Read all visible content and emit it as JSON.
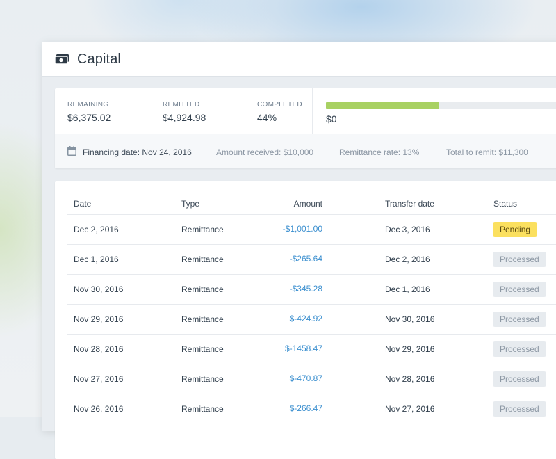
{
  "header": {
    "title": "Capital",
    "icon": "cash-icon"
  },
  "summary": {
    "remaining": {
      "label": "REMAINING",
      "value": "$6,375.02"
    },
    "remitted": {
      "label": "REMITTED",
      "value": "$4,924.98"
    },
    "completed": {
      "label": "COMPLETED",
      "value": "44%"
    },
    "progress": {
      "fraction": 0.44,
      "value_label": "$0",
      "fill_color": "#a8d162"
    },
    "financing_date": "Financing date: Nov 24, 2016",
    "amount_received": "Amount received: $10,000",
    "remittance_rate": "Remittance rate: 13%",
    "total_to_remit": "Total to remit: $11,300"
  },
  "table": {
    "headers": {
      "date": "Date",
      "type": "Type",
      "amount": "Amount",
      "transfer_date": "Transfer date",
      "status": "Status"
    },
    "rows": [
      {
        "date": "Dec 2, 2016",
        "type": "Remittance",
        "amount": "-$1,001.00",
        "transfer_date": "Dec 3, 2016",
        "status": "Pending",
        "status_kind": "pending"
      },
      {
        "date": "Dec 1, 2016",
        "type": "Remittance",
        "amount": "-$265.64",
        "transfer_date": "Dec 2, 2016",
        "status": "Processed",
        "status_kind": "processed"
      },
      {
        "date": "Nov 30, 2016",
        "type": "Remittance",
        "amount": "-$345.28",
        "transfer_date": "Dec 1, 2016",
        "status": "Processed",
        "status_kind": "processed"
      },
      {
        "date": "Nov 29, 2016",
        "type": "Remittance",
        "amount": "$-424.92",
        "transfer_date": "Nov 30, 2016",
        "status": "Processed",
        "status_kind": "processed"
      },
      {
        "date": "Nov 28, 2016",
        "type": "Remittance",
        "amount": "$-1458.47",
        "transfer_date": "Nov 29, 2016",
        "status": "Processed",
        "status_kind": "processed"
      },
      {
        "date": "Nov 27, 2016",
        "type": "Remittance",
        "amount": "$-470.87",
        "transfer_date": "Nov 28, 2016",
        "status": "Processed",
        "status_kind": "processed"
      },
      {
        "date": "Nov 26, 2016",
        "type": "Remittance",
        "amount": "$-266.47",
        "transfer_date": "Nov 27, 2016",
        "status": "Processed",
        "status_kind": "processed"
      }
    ]
  },
  "colors": {
    "accent_link": "#3b8fcf",
    "pending": "#fbe05f",
    "processed": "#e7ebef"
  }
}
